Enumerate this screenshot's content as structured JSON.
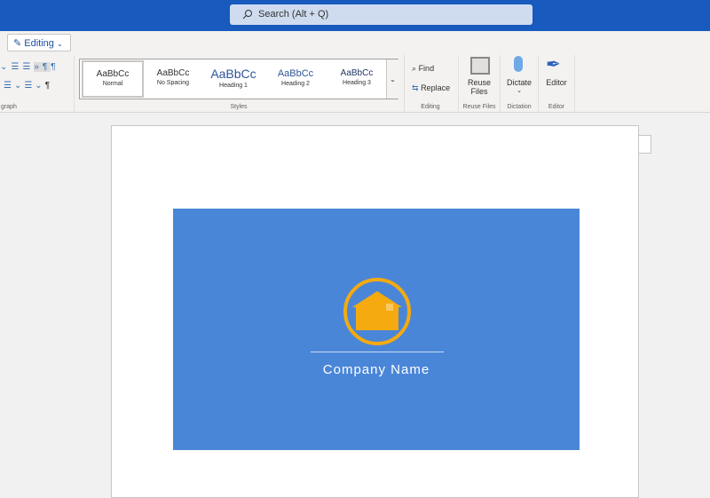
{
  "search": {
    "placeholder": "Search (Alt + Q)"
  },
  "mode": {
    "label": "Editing"
  },
  "groups": {
    "paragraph": "graph",
    "styles": "Styles",
    "editing": "Editing",
    "reuse": "Reuse Files",
    "dictation": "Dictation",
    "editor": "Editor"
  },
  "styles": [
    {
      "sample": "AaBbCc",
      "name": "Normal"
    },
    {
      "sample": "AaBbCc",
      "name": "No Spacing"
    },
    {
      "sample": "AaBbCc",
      "name": "Heading 1"
    },
    {
      "sample": "AaBbCc",
      "name": "Heading 2"
    },
    {
      "sample": "AaBbCc",
      "name": "Heading 3"
    }
  ],
  "editing": {
    "find": "Find",
    "replace": "Replace"
  },
  "reuse": {
    "line1": "Reuse",
    "line2": "Files"
  },
  "dictate": {
    "label": "Dictate"
  },
  "editor": {
    "label": "Editor"
  },
  "document": {
    "company_name": "Company Name"
  },
  "colors": {
    "brand": "#185abd",
    "card": "#4a86d8",
    "logo": "#f5aa10"
  }
}
